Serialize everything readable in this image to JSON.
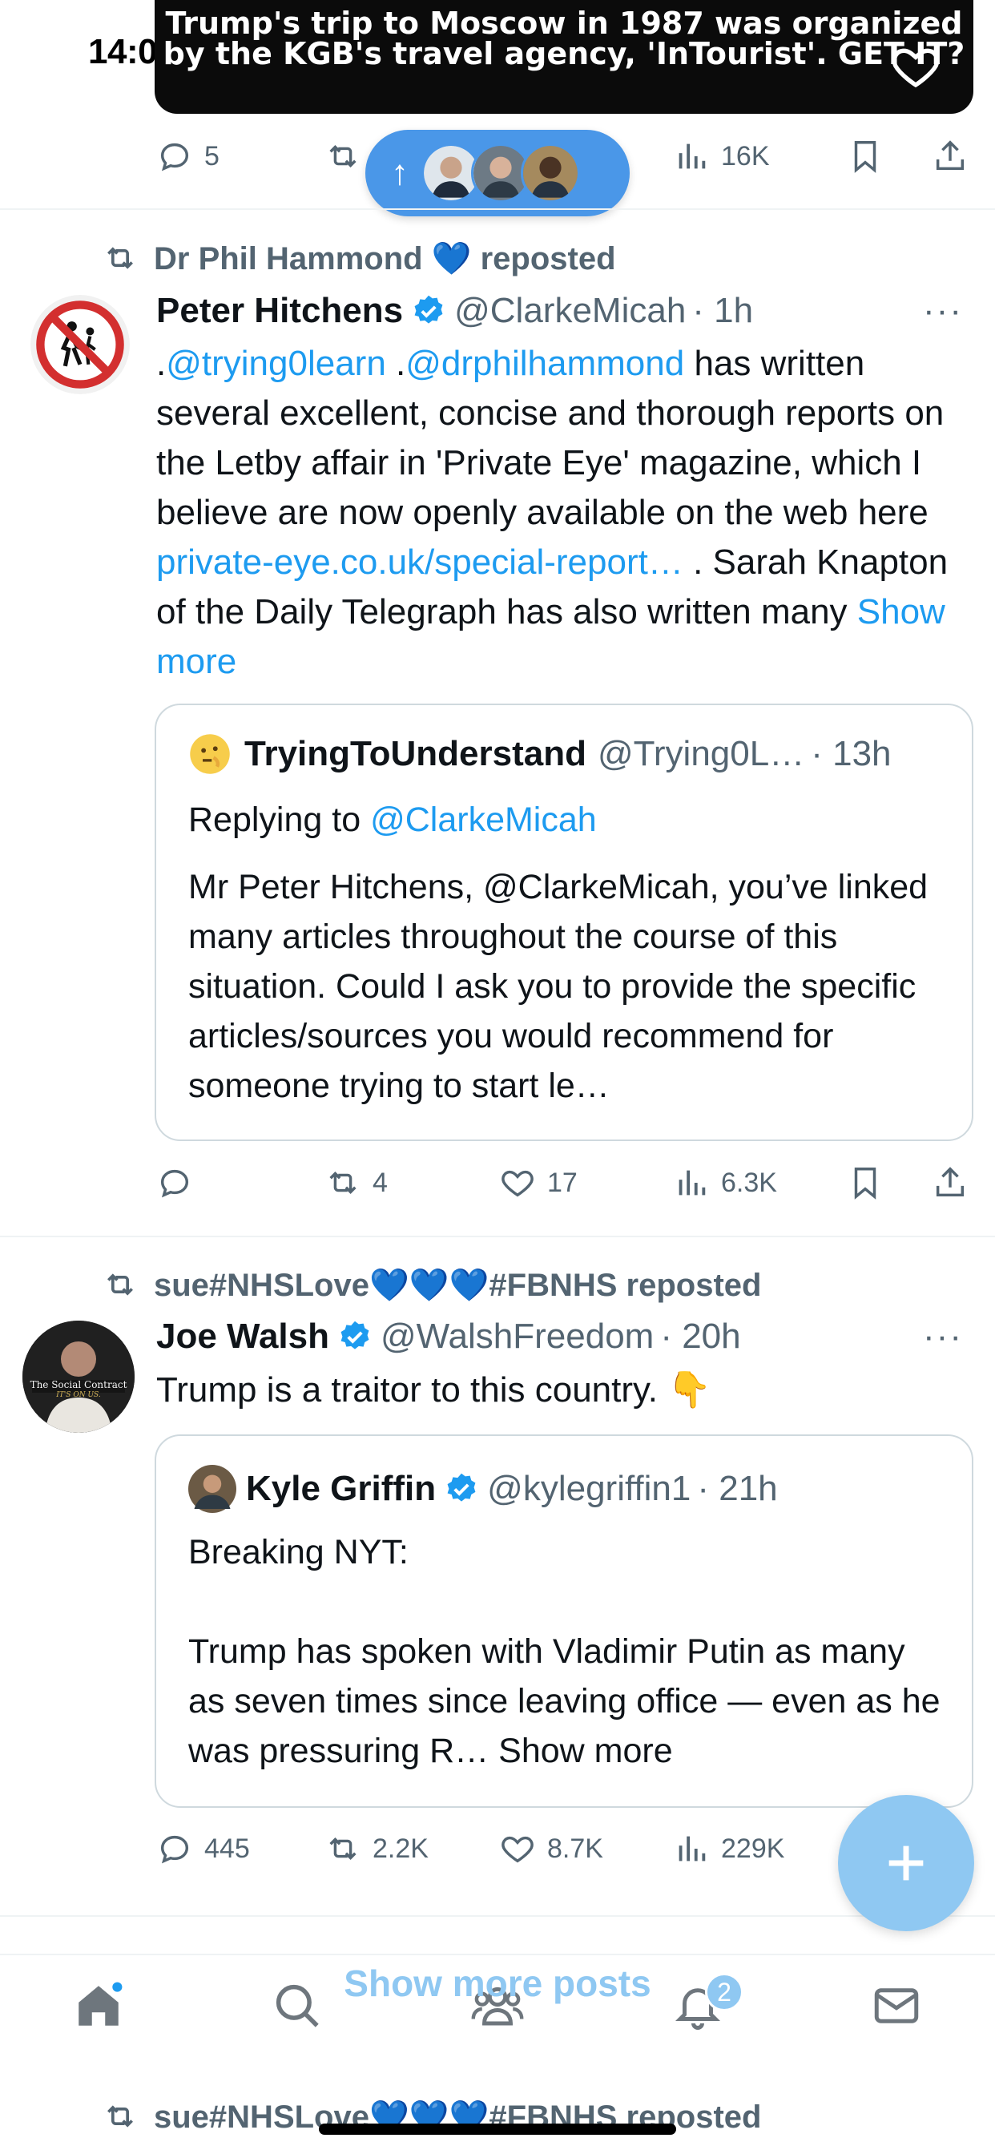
{
  "status": {
    "time": "14:0"
  },
  "top_media": {
    "caption": "Trump's trip to Moscow in 1987 was organized by the KGB's travel agency, 'InTourist'. GET IT?"
  },
  "top_actions": {
    "replies": "5",
    "views": "16K"
  },
  "posts": [
    {
      "repost_by": "Dr Phil Hammond 💙 reposted",
      "name": "Peter Hitchens",
      "handle": "@ClarkeMicah",
      "time": "· 1h",
      "more": "···",
      "body": {
        "prefix": ".",
        "mention1": "@trying0learn",
        "sep": " .",
        "mention2": "@drphilhammond",
        "text1": " has written several excellent, concise and thorough reports on the Letby affair  in 'Private Eye' magazine, which I believe are now openly available on the web here ",
        "link": "private-eye.co.uk/special-report…",
        "text2": " . Sarah Knapton of the Daily Telegraph has also written many ",
        "show_more": "Show more"
      },
      "quote": {
        "name": "TryingToUnderstand",
        "handle": "@Trying0L…",
        "time": "· 13h",
        "replying_prefix": "Replying to ",
        "replying_to": "@ClarkeMicah",
        "text": "Mr Peter Hitchens, @ClarkeMicah, you’ve linked many articles throughout the course of this situation. Could I ask you to provide the specific articles/sources you would recommend for someone trying to start le…"
      },
      "actions": {
        "replies": "",
        "reposts": "4",
        "likes": "17",
        "views": "6.3K"
      }
    },
    {
      "repost_by": "sue#NHSLove💙💙💙#FBNHS reposted",
      "name": "Joe Walsh",
      "handle": "@WalshFreedom",
      "time": "· 20h",
      "more": "···",
      "body_text": "Trump is a traitor to this country. 👇",
      "quote": {
        "name": "Kyle Griffin",
        "handle": "@kylegriffin1",
        "time": "· 21h",
        "line1": "Breaking NYT:",
        "text": "Trump has spoken with Vladimir Putin as many as seven times since leaving office — even as he was pressuring R…",
        "show_more": " Show more"
      },
      "actions": {
        "replies": "445",
        "reposts": "2.2K",
        "likes": "8.7K",
        "views": "229K"
      }
    }
  ],
  "avatar_text": {
    "line1": "The Social Contract",
    "line2": "IT'S ON US."
  },
  "show_more_posts": "Show more posts",
  "notification_count": "2",
  "next_repost": "sue#NHSLove💙💙💙#FBNHS reposted",
  "colors": {
    "accent": "#1d9bf0",
    "pill": "#4a97e8",
    "fab": "#8fc8f2",
    "muted": "#536471"
  }
}
